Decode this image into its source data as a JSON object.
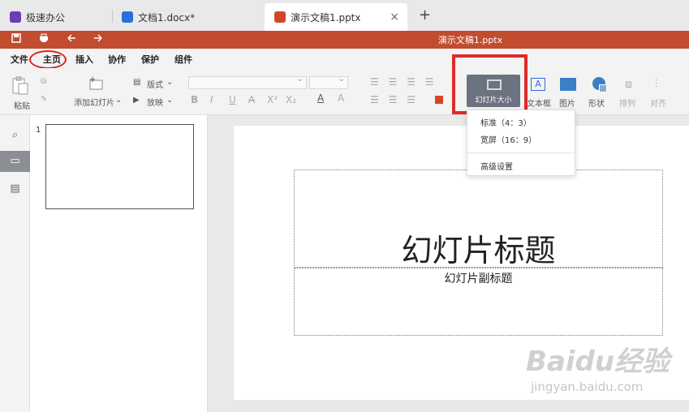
{
  "tabs": [
    {
      "label": "极速办公",
      "icon": "rocket-icon",
      "color": "#6a3fb5"
    },
    {
      "label": "文档1.docx*",
      "icon": "doc-icon",
      "color": "#2b6ed9"
    },
    {
      "label": "演示文稿1.pptx",
      "icon": "ppt-icon",
      "color": "#d24726",
      "active": true
    }
  ],
  "new_tab": "+",
  "close_tab": "×",
  "title_bar": {
    "title": "演示文稿1.pptx",
    "color": "#c24c2e"
  },
  "menu": [
    "文件",
    "主页",
    "插入",
    "协作",
    "保护",
    "组件"
  ],
  "ribbon": {
    "paste": "粘贴",
    "add_slide": "添加幻灯片",
    "layout": "版式",
    "play": "放映",
    "format": [
      "B",
      "I",
      "U",
      "A",
      "X²",
      "X₂"
    ],
    "slide_size": "幻灯片大小",
    "textbox": "文本框",
    "picture": "图片",
    "shape": "形状",
    "arrange": "排列",
    "align": "对齐"
  },
  "dropdown": {
    "items": [
      "标准（4：3）",
      "宽屏（16：9）"
    ],
    "advanced": "高级设置"
  },
  "thumbnail": {
    "number": "1"
  },
  "slide": {
    "title": "幻灯片标题",
    "subtitle": "幻灯片副标题"
  },
  "watermark": {
    "main": "Baidu经验",
    "sub": "jingyan.baidu.com"
  },
  "colors": {
    "highlight_red": "#e02a2a",
    "selected_button": "#6b7280"
  }
}
